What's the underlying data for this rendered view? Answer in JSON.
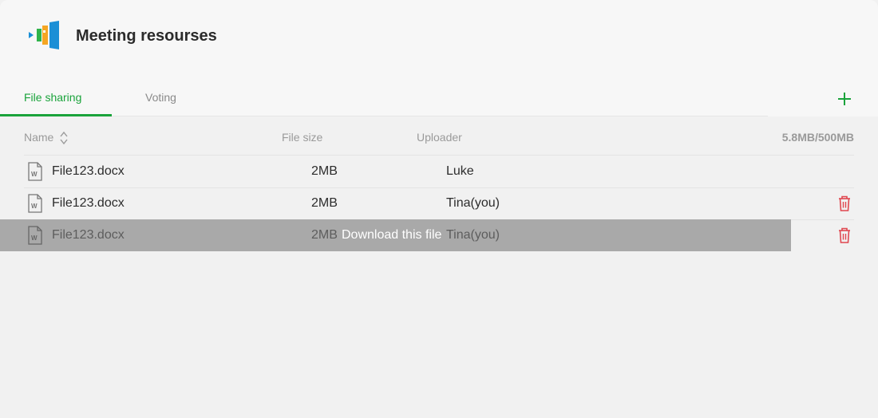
{
  "header": {
    "title": "Meeting resourses",
    "logo_icon": "app-logo-icon"
  },
  "tabs": [
    {
      "label": "File sharing",
      "active": true
    },
    {
      "label": "Voting",
      "active": false
    }
  ],
  "add_icon": "plus-icon",
  "columns": {
    "name": "Name",
    "file_size": "File size",
    "uploader": "Uploader",
    "quota": "5.8MB/500MB"
  },
  "files": [
    {
      "name": "File123.docx",
      "size": "2MB",
      "uploader": "Luke",
      "deletable": false
    },
    {
      "name": "File123.docx",
      "size": "2MB",
      "uploader": "Tina(you)",
      "deletable": true
    },
    {
      "name": "File123.docx",
      "size": "2MB",
      "uploader": "Tina(you)",
      "deletable": true,
      "hovered": true
    }
  ],
  "hover_tooltip": "Download this file",
  "colors": {
    "accent": "#1aa33b",
    "danger": "#e0474f",
    "hover_overlay": "#a9a9a9"
  }
}
